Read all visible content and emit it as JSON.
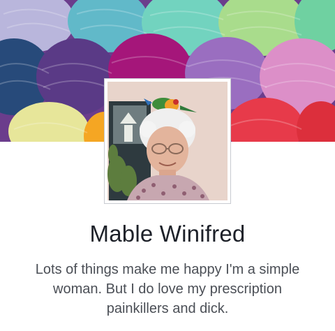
{
  "profile": {
    "name": "Mable Winifred",
    "bio": "Lots of things make me happy I'm a simple woman. But I do love my prescription painkillers and dick."
  },
  "cover": {
    "subject": "balls of colorful yarn",
    "yarn_colors": [
      "#b9b6dc",
      "#61b9c9",
      "#72d3bf",
      "#a9dc8c",
      "#6fd1a1",
      "#274a7a",
      "#5a3a86",
      "#a5167a",
      "#9a6ec0",
      "#dc8fc8",
      "#e7e69a",
      "#f5a623",
      "#e73a4a"
    ]
  },
  "avatar": {
    "subject": "elderly woman with a parrot on her head"
  }
}
